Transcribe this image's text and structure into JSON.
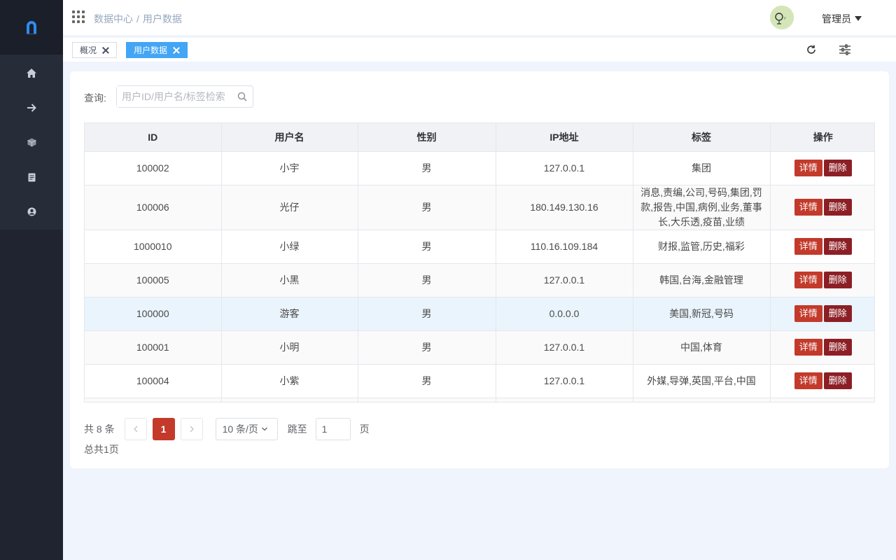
{
  "header": {
    "breadcrumb": [
      "数据中心",
      "用户数据"
    ],
    "breadcrumb_sep": "/",
    "user_name": "管理员"
  },
  "sidebar": {
    "items": [
      {
        "icon": "home-icon"
      },
      {
        "icon": "arrow-right-icon"
      },
      {
        "icon": "cube-icon"
      },
      {
        "icon": "document-icon"
      },
      {
        "icon": "user-circle-icon"
      }
    ]
  },
  "tags": [
    {
      "label": "概况",
      "active": false
    },
    {
      "label": "用户数据",
      "active": true
    }
  ],
  "query": {
    "label": "查询:",
    "placeholder": "用户ID/用户名/标签检索"
  },
  "table": {
    "columns": [
      "ID",
      "用户名",
      "性别",
      "IP地址",
      "标签",
      "操作"
    ],
    "detail_label": "详情",
    "delete_label": "删除",
    "rows": [
      {
        "id": "100002",
        "name": "小宇",
        "gender": "男",
        "ip": "127.0.0.1",
        "tags": "集团"
      },
      {
        "id": "100006",
        "name": "光仔",
        "gender": "男",
        "ip": "180.149.130.16",
        "tags": "消息,责编,公司,号码,集团,罚款,报告,中国,病例,业务,董事长,大乐透,疫苗,业绩"
      },
      {
        "id": "1000010",
        "name": "小绿",
        "gender": "男",
        "ip": "110.16.109.184",
        "tags": "财报,监管,历史,福彩"
      },
      {
        "id": "100005",
        "name": "小黑",
        "gender": "男",
        "ip": "127.0.0.1",
        "tags": "韩国,台海,金融管理"
      },
      {
        "id": "100000",
        "name": "游客",
        "gender": "男",
        "ip": "0.0.0.0",
        "tags": "美国,新冠,号码"
      },
      {
        "id": "100001",
        "name": "小明",
        "gender": "男",
        "ip": "127.0.0.1",
        "tags": "中国,体育"
      },
      {
        "id": "100004",
        "name": "小紫",
        "gender": "男",
        "ip": "127.0.0.1",
        "tags": "外媒,导弹,英国,平台,中国"
      }
    ]
  },
  "pagination": {
    "total_text": "共 8 条",
    "current_page": "1",
    "page_size": "10 条/页",
    "jump_label": "跳至",
    "jump_value": "1",
    "page_suffix": "页",
    "total_pages_text": "总共1页"
  },
  "colors": {
    "sidebar_bg": "#1f2430",
    "accent_tag": "#42a5f5",
    "detail_btn": "#c33a2b",
    "delete_btn": "#8c1f25",
    "page_bg": "#f0f4fc"
  }
}
